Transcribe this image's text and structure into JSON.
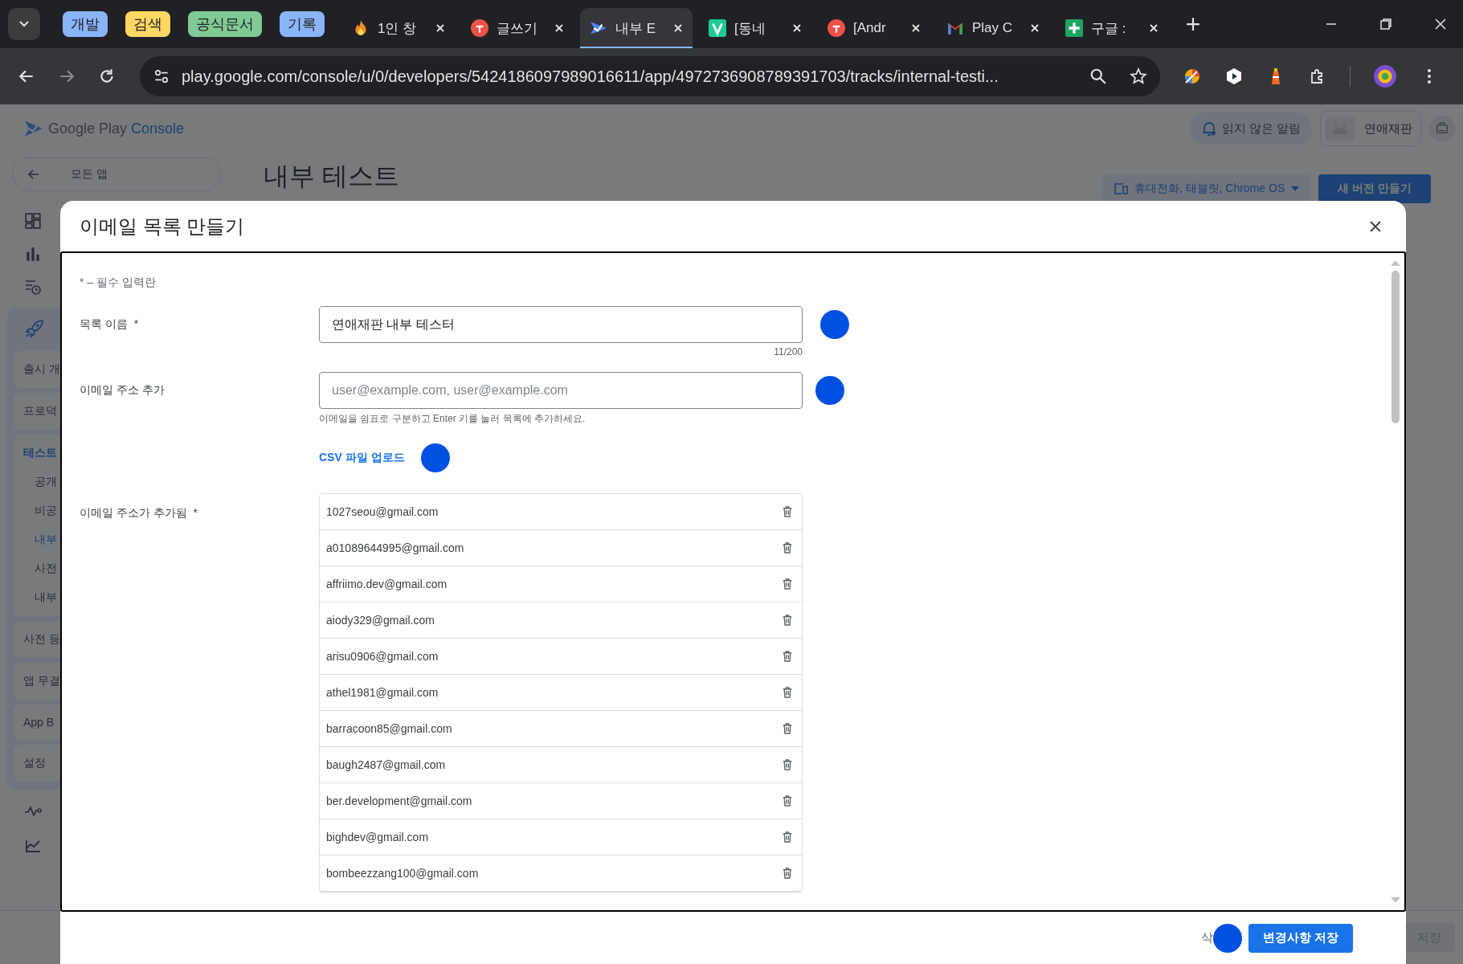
{
  "browser": {
    "tab_groups": [
      {
        "label": "개발",
        "color": "#8ab4f8"
      },
      {
        "label": "검색",
        "color": "#fdd663"
      },
      {
        "label": "공식문서",
        "color": "#81c995"
      },
      {
        "label": "기록",
        "color": "#8ab4f8"
      }
    ],
    "tabs": [
      {
        "label": "1인 창",
        "kind": "fire",
        "selected": false
      },
      {
        "label": "글쓰기",
        "kind": "red",
        "selected": false
      },
      {
        "label": "내부 E",
        "kind": "play",
        "selected": true
      },
      {
        "label": "[동네",
        "kind": "v",
        "selected": false
      },
      {
        "label": "[Andr",
        "kind": "red",
        "selected": false
      },
      {
        "label": "Play C",
        "kind": "gmail",
        "selected": false
      },
      {
        "label": "구글 :",
        "kind": "sheets",
        "selected": false
      }
    ],
    "url": "play.google.com/console/u/0/developers/5424186097989016611/app/4972736908789391703/tracks/internal-testi..."
  },
  "console": {
    "logo": "Google Play",
    "logo_accent": "Console",
    "back": "모든 앱",
    "page_title": "내부 테스트",
    "notifications": "읽지 않은 알림",
    "app_name": "연애재판",
    "device_filter": "휴대전화, 태블릿, Chrome OS",
    "create_release": "새 버전 만들기",
    "save": "저장",
    "nav": [
      {
        "label": "출시 개",
        "selected": false
      },
      {
        "label": "프로덕",
        "selected": false
      },
      {
        "label": "테스트",
        "selected": true,
        "children": [
          {
            "label": "공개",
            "selected": false
          },
          {
            "label": "비공",
            "selected": false
          },
          {
            "label": "내부",
            "selected": true
          },
          {
            "label": "사전",
            "selected": false
          },
          {
            "label": "내부",
            "selected": false
          }
        ]
      },
      {
        "label": "사전 등",
        "selected": false
      },
      {
        "label": "앱 무결",
        "selected": false
      },
      {
        "label": "App B",
        "selected": false
      },
      {
        "label": "설정",
        "selected": false
      }
    ]
  },
  "dialog": {
    "title": "이메일 목록 만들기",
    "required_note": "* – 필수 입력란",
    "list_name": {
      "label": "목록 이름  *",
      "value": "연애재판 내부 테스터",
      "counter": "11/200"
    },
    "add_emails": {
      "label": "이메일 주소 추가",
      "placeholder": "user@example.com, user@example.com",
      "helper": "이메일을 쉼표로 구분하고 Enter 키를 눌러 목록에 추가하세요."
    },
    "csv_upload": "CSV 파일 업로드",
    "added_label": "이메일 주소가 추가됨  *",
    "emails": [
      "1027seou@gmail.com",
      "a01089644995@gmail.com",
      "affriimo.dev@gmail.com",
      "aiody329@gmail.com",
      "arisu0906@gmail.com",
      "athel1981@gmail.com",
      "barracoon85@gmail.com",
      "baugh2487@gmail.com",
      "ber.development@gmail.com",
      "bighdev@gmail.com",
      "bombeezzang100@gmail.com"
    ],
    "delete_partial": "삭",
    "save": "변경사항 저장"
  }
}
